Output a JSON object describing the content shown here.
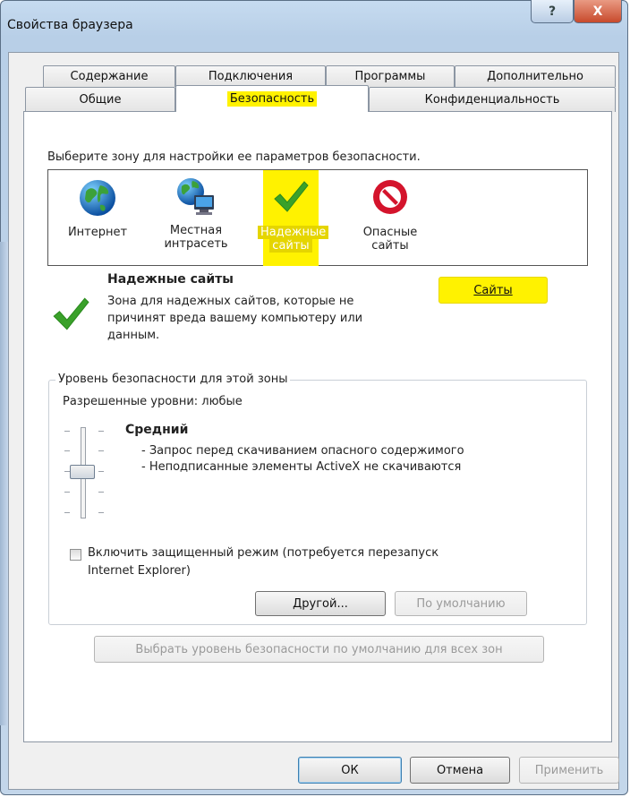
{
  "window": {
    "title": "Свойства браузера",
    "help_glyph": "?",
    "close_glyph": "X"
  },
  "tabs_row1": [
    "Содержание",
    "Подключения",
    "Программы",
    "Дополнительно"
  ],
  "tabs_row2": [
    "Общие",
    "Безопасность",
    "Конфиденциальность"
  ],
  "zone_prompt": "Выберите зону для настройки ее параметров безопасности.",
  "zones": [
    {
      "line1": "Интернет",
      "line2": "",
      "icon": "globe-icon"
    },
    {
      "line1": "Местная",
      "line2": "интрасеть",
      "icon": "intranet-icon"
    },
    {
      "line1": "Надежные",
      "line2": "сайты",
      "icon": "checkmark-icon"
    },
    {
      "line1": "Опасные",
      "line2": "сайты",
      "icon": "no-entry-icon"
    }
  ],
  "selected_zone": {
    "title": "Надежные сайты",
    "desc1": "Зона для надежных сайтов, которые не",
    "desc2": "причинят вреда вашему компьютеру или",
    "desc3": "данным."
  },
  "sites_button": "Сайты",
  "security_group": {
    "title": "Уровень безопасности для этой зоны",
    "allowed": "Разрешенные уровни: любые",
    "level_name": "Средний",
    "bullet1": "- Запрос перед скачиванием опасного содержимого",
    "bullet2": "- Неподписанные элементы ActiveX не скачиваются",
    "protected_mode_line1": "Включить защищенный режим (потребуется перезапуск",
    "protected_mode_line2": "Internet Explorer)",
    "protected_mode_checked": false,
    "custom_button": "Другой...",
    "default_button": "По умолчанию"
  },
  "reset_all_button": "Выбрать уровень безопасности по умолчанию для всех зон",
  "dialog_buttons": {
    "ok": "ОК",
    "cancel": "Отмена",
    "apply": "Применить"
  },
  "colors": {
    "highlight": "#fff200",
    "frame": "#bcd3ea",
    "check_green": "#3aa12a",
    "no_red": "#d4142c"
  }
}
